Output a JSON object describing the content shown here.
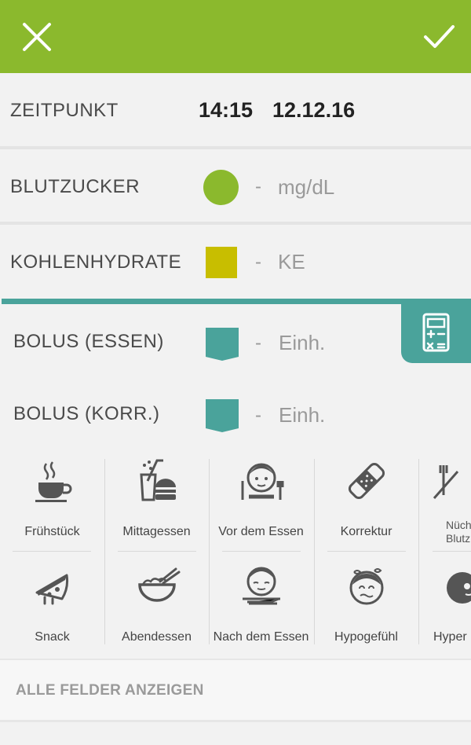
{
  "header": {
    "close_icon": "close-icon",
    "confirm_icon": "check-icon",
    "color": "#8bb92d"
  },
  "time_row": {
    "label": "ZEITPUNKT",
    "time": "14:15",
    "date": "12.12.16"
  },
  "bz_row": {
    "label": "BLUTZUCKER",
    "value": "-",
    "unit": "mg/dL",
    "marker_color": "#8bb92d"
  },
  "kh_row": {
    "label": "KOHLENHYDRATE",
    "value": "-",
    "unit": "KE",
    "marker_color": "#c8be00"
  },
  "bolus": {
    "accent": "#4aa39b",
    "calculator_icon": "calculator-icon",
    "essen": {
      "label": "BOLUS (ESSEN)",
      "value": "-",
      "unit": "Einh."
    },
    "korr": {
      "label": "BOLUS (KORR.)",
      "value": "-",
      "unit": "Einh."
    }
  },
  "tags": [
    {
      "label": "Frühstück",
      "icon": "coffee-cup-icon"
    },
    {
      "label": "Mittagessen",
      "icon": "burger-drink-icon"
    },
    {
      "label": "Vor dem Essen",
      "icon": "face-with-cutlery-icon"
    },
    {
      "label": "Korrektur",
      "icon": "bandage-icon"
    },
    {
      "label": "Nüch",
      "label2": "Blutz",
      "icon": "no-cutlery-icon"
    },
    {
      "label": "Snack",
      "icon": "pizza-slice-icon"
    },
    {
      "label": "Abendessen",
      "icon": "bowl-chopsticks-icon"
    },
    {
      "label": "Nach dem Essen",
      "icon": "face-full-plate-icon"
    },
    {
      "label": "Hypogefühl",
      "icon": "dizzy-face-icon"
    },
    {
      "label": "Hyper",
      "icon": "hyper-face-icon"
    }
  ],
  "footer": {
    "all_fields": "ALLE FELDER ANZEIGEN"
  }
}
